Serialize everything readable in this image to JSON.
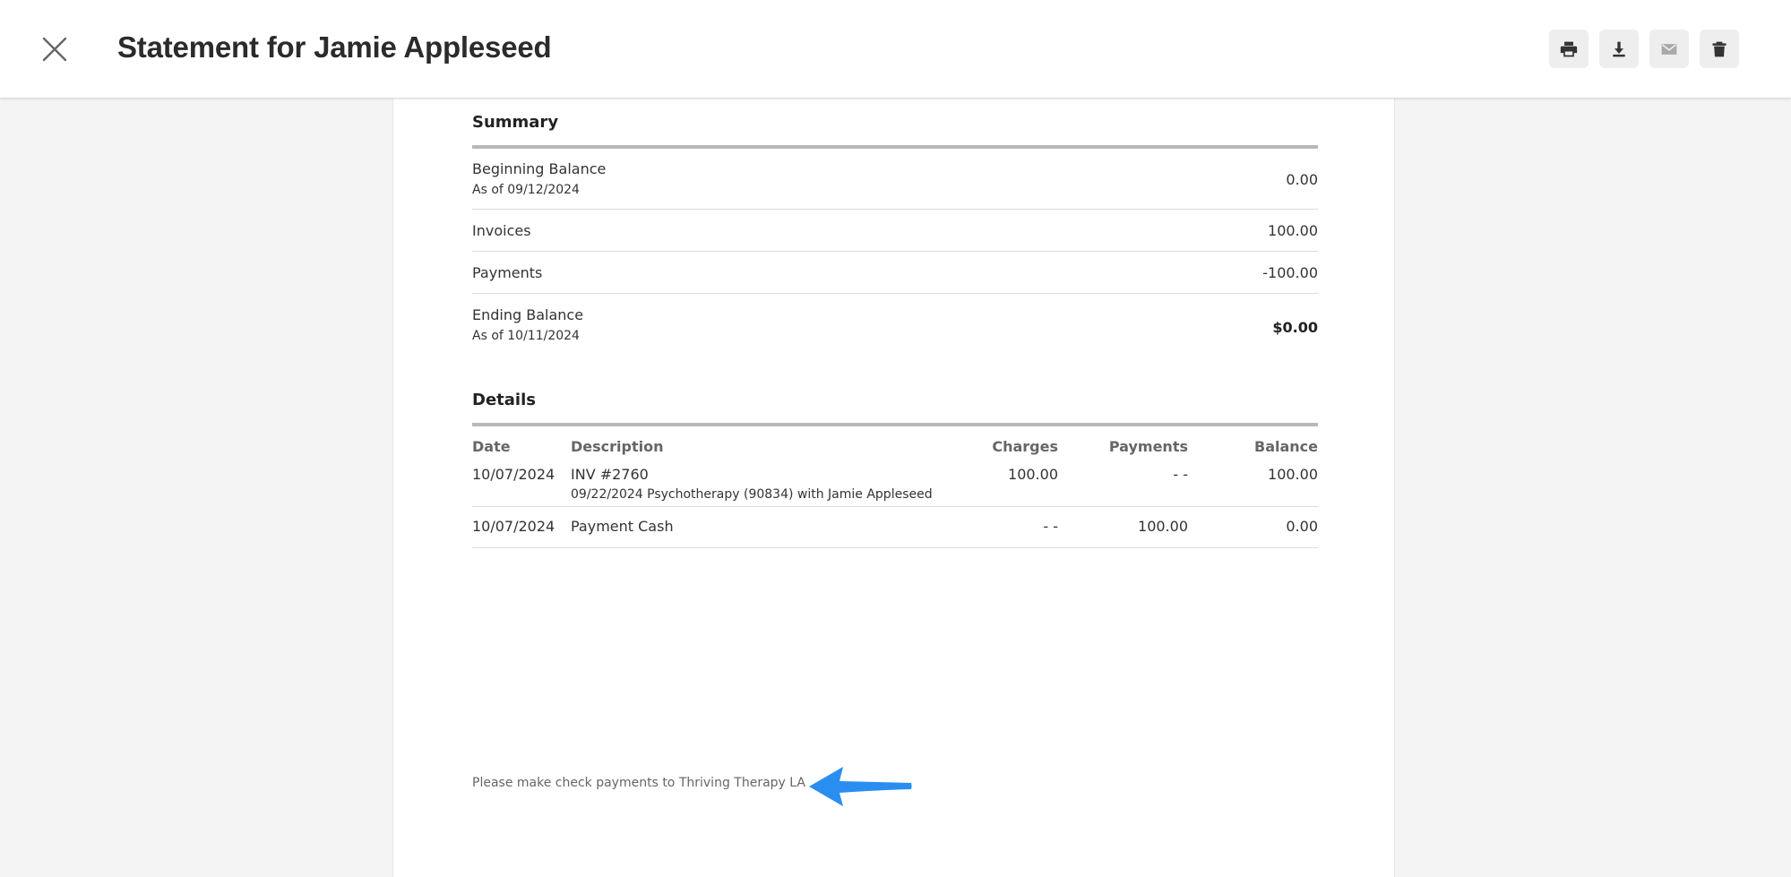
{
  "header": {
    "title": "Statement for Jamie Appleseed",
    "close_icon": "close-icon",
    "actions": [
      {
        "name": "print-button",
        "icon": "print-icon"
      },
      {
        "name": "download-button",
        "icon": "download-icon"
      },
      {
        "name": "email-button",
        "icon": "mail-icon",
        "disabled": true
      },
      {
        "name": "delete-button",
        "icon": "trash-icon"
      }
    ]
  },
  "summary": {
    "title": "Summary",
    "rows": [
      {
        "label": "Beginning Balance",
        "sub": "As of 09/12/2024",
        "value": "0.00"
      },
      {
        "label": "Invoices",
        "value": "100.00"
      },
      {
        "label": "Payments",
        "value": "-100.00"
      },
      {
        "label": "Ending Balance",
        "sub": "As of 10/11/2024",
        "value": "$0.00"
      }
    ]
  },
  "details": {
    "title": "Details",
    "columns": {
      "date": "Date",
      "description": "Description",
      "charges": "Charges",
      "payments": "Payments",
      "balance": "Balance"
    },
    "rows": [
      {
        "date": "10/07/2024",
        "description": "INV #2760",
        "sub": "09/22/2024 Psychotherapy (90834) with Jamie Appleseed",
        "charges": "100.00",
        "payments": "- -",
        "balance": "100.00"
      },
      {
        "date": "10/07/2024",
        "description": "Payment Cash",
        "charges": "- -",
        "payments": "100.00",
        "balance": "0.00"
      }
    ]
  },
  "footer": {
    "note": "Please make check payments to Thriving Therapy LA"
  },
  "colors": {
    "arrow": "#2a8ef0",
    "header_bg": "#ffffff",
    "canvas_bg": "#f4f4f5"
  }
}
